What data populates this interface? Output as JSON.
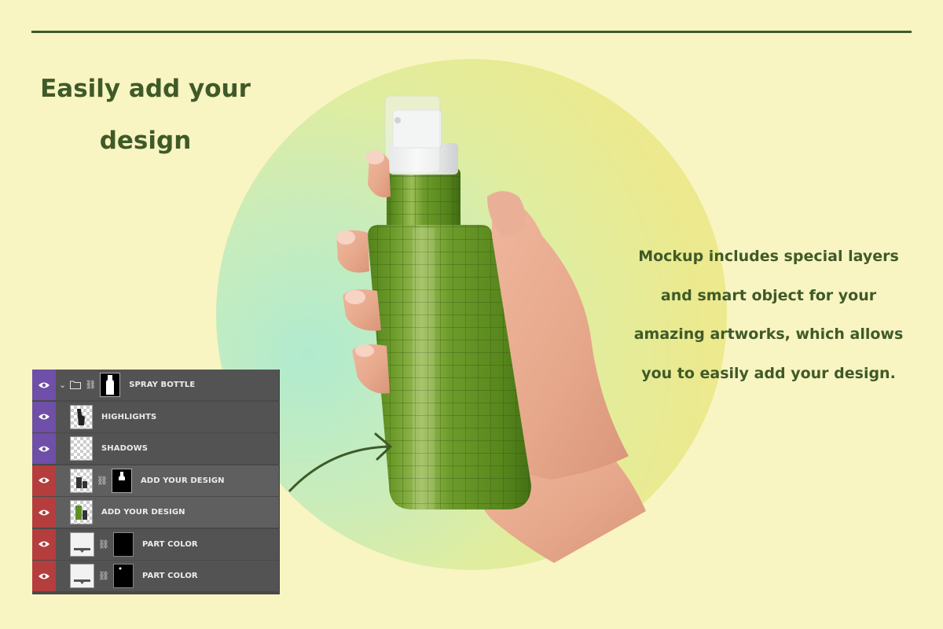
{
  "headline": {
    "line1": "Easily add your",
    "line2": "design"
  },
  "description": {
    "line1": "Mockup includes special layers",
    "line2": "and smart object for your",
    "line3": "amazing artworks, which allows",
    "line4": "you to easily add your design."
  },
  "colors": {
    "background": "#f8f5c2",
    "text_dark_green": "#3f5a28",
    "bottle_green": "#5e8f23",
    "panel_bg": "#535353",
    "eye_purple": "#6f4fa7",
    "eye_red": "#b53d3d"
  },
  "layers_panel": {
    "rows": [
      {
        "label": "SPRAY BOTTLE",
        "eye_color": "purple",
        "icons": [
          "eye-icon",
          "chevron-down-icon",
          "folder-icon",
          "link-icon"
        ]
      },
      {
        "label": "HIGHLIGHTS",
        "eye_color": "purple",
        "icons": [
          "eye-icon"
        ]
      },
      {
        "label": "SHADOWS",
        "eye_color": "purple",
        "icons": [
          "eye-icon"
        ]
      },
      {
        "label": "ADD YOUR DESIGN",
        "eye_color": "red",
        "icons": [
          "eye-icon",
          "link-icon"
        ]
      },
      {
        "label": "ADD YOUR DESIGN",
        "eye_color": "red",
        "icons": [
          "eye-icon"
        ]
      },
      {
        "label": "PART COLOR",
        "eye_color": "red",
        "icons": [
          "eye-icon",
          "link-icon"
        ]
      },
      {
        "label": "PART COLOR",
        "eye_color": "red",
        "icons": [
          "eye-icon",
          "link-icon"
        ]
      }
    ]
  }
}
